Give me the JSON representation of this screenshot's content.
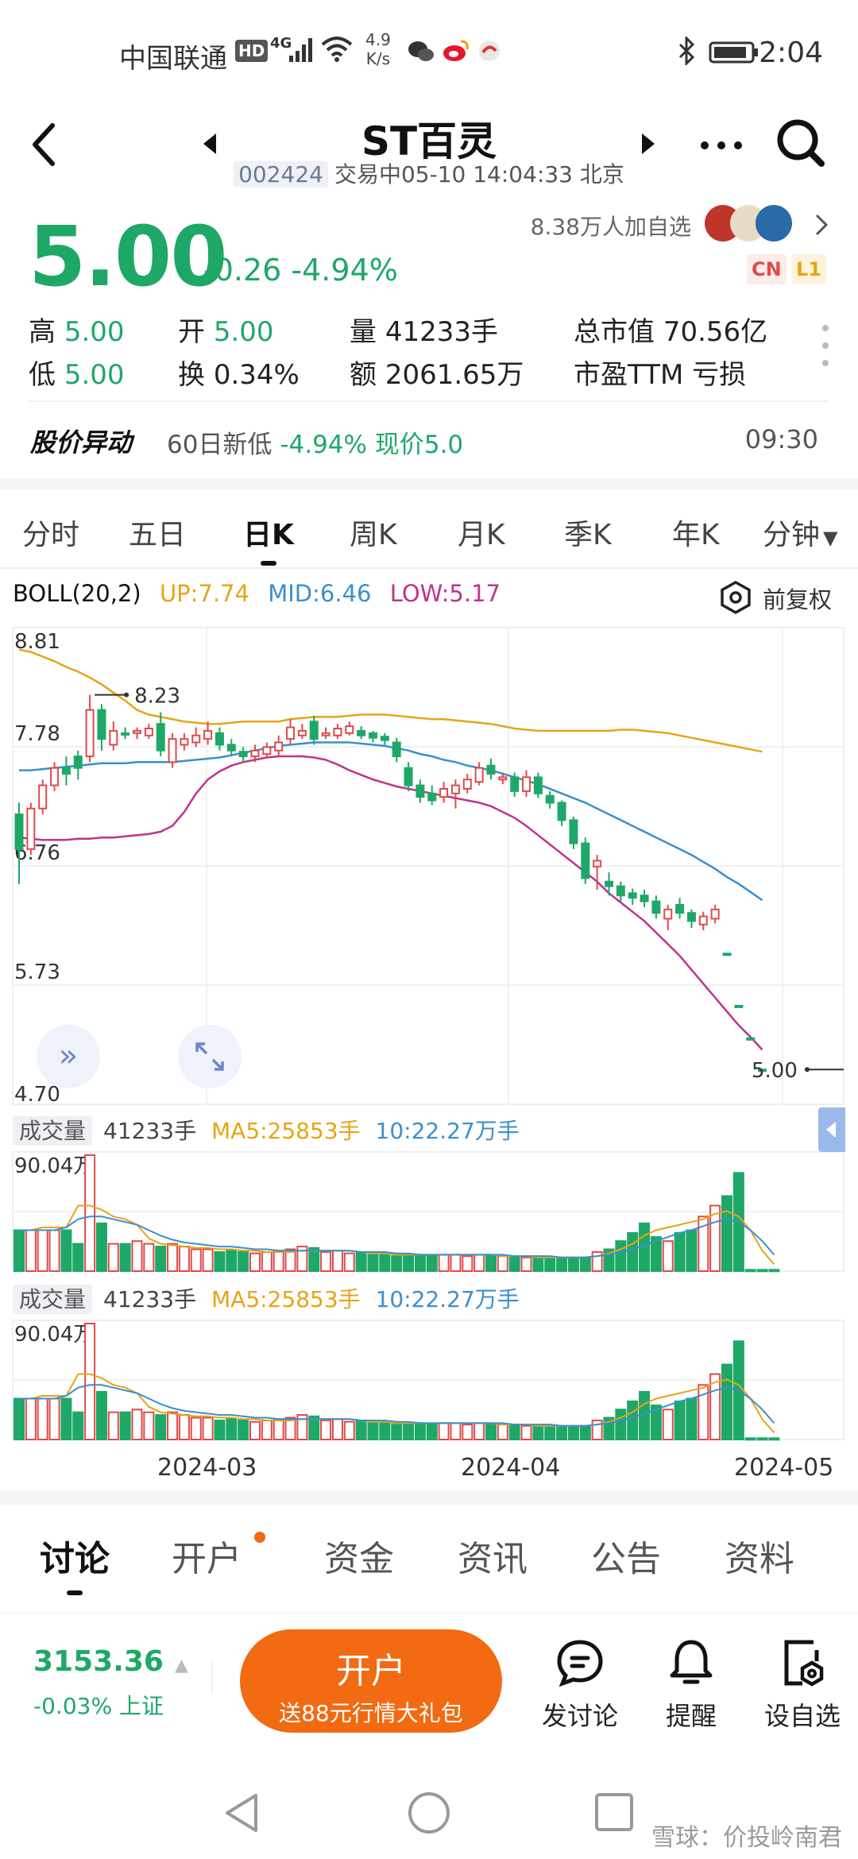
{
  "status_bar": {
    "carrier": "中国联通",
    "hd": "HD",
    "net_gen": "4G",
    "net_speed": "4.9",
    "net_unit": "K/s",
    "time": "2:04"
  },
  "header": {
    "title": "ST百灵",
    "code": "002424",
    "trade_status": "交易中05-10 14:04:33 北京"
  },
  "quote": {
    "price": "5.00",
    "change": "-0.26",
    "change_pct": "-4.94%",
    "followers": "8.38万人加自选",
    "tag_cn": "CN",
    "tag_l1": "L1",
    "high_label": "高",
    "high": "5.00",
    "low_label": "低",
    "low": "5.00",
    "open_label": "开",
    "open": "5.00",
    "turnover_label": "换",
    "turnover": "0.34%",
    "volume_label": "量",
    "volume": "41233手",
    "amount_label": "额",
    "amount": "2061.65万",
    "mktcap_label": "总市值",
    "mktcap": "70.56亿",
    "pe_label": "市盈TTM",
    "pe": "亏损"
  },
  "alert": {
    "title": "股价异动",
    "text_prefix": "60日新低",
    "text_pct": "-4.94%",
    "text_suffix": "现价5.0",
    "time": "09:30"
  },
  "kline_tabs": [
    "分时",
    "五日",
    "日K",
    "周K",
    "月K",
    "季K",
    "年K",
    "分钟"
  ],
  "active_kline_tab": "日K",
  "boll": {
    "label": "BOLL(20,2)",
    "up": "UP:7.74",
    "mid": "MID:6.46",
    "low": "LOW:5.17",
    "adjust": "前复权"
  },
  "colors": {
    "up": "#e04a4a",
    "down": "#1ea868",
    "boll_up": "#e8a317",
    "boll_mid": "#3a8fd0",
    "boll_low": "#c0338a",
    "accent": "#f26a12"
  },
  "chart_data": {
    "type": "candlestick",
    "y_ticks": [
      "8.81",
      "7.78",
      "6.76",
      "5.73",
      "4.70"
    ],
    "ylim": [
      4.7,
      8.81
    ],
    "max_label": "8.23",
    "last_label": "5.00",
    "x_ticks": [
      "2024-03",
      "2024-04",
      "2024-05"
    ],
    "candles": [
      {
        "o": 7.2,
        "c": 6.9,
        "h": 7.3,
        "l": 6.6
      },
      {
        "o": 6.9,
        "c": 7.25,
        "h": 7.3,
        "l": 6.85
      },
      {
        "o": 7.25,
        "c": 7.45,
        "h": 7.5,
        "l": 7.2
      },
      {
        "o": 7.45,
        "c": 7.6,
        "h": 7.65,
        "l": 7.4
      },
      {
        "o": 7.6,
        "c": 7.55,
        "h": 7.7,
        "l": 7.45
      },
      {
        "o": 7.7,
        "c": 7.6,
        "h": 7.75,
        "l": 7.5
      },
      {
        "o": 7.7,
        "c": 8.1,
        "h": 8.23,
        "l": 7.65
      },
      {
        "o": 8.1,
        "c": 7.85,
        "h": 8.15,
        "l": 7.75
      },
      {
        "o": 7.8,
        "c": 7.92,
        "h": 8.0,
        "l": 7.75
      },
      {
        "o": 7.9,
        "c": 7.9,
        "h": 7.95,
        "l": 7.85
      },
      {
        "o": 7.9,
        "c": 7.92,
        "h": 7.95,
        "l": 7.85
      },
      {
        "o": 7.88,
        "c": 7.94,
        "h": 7.98,
        "l": 7.85
      },
      {
        "o": 7.98,
        "c": 7.75,
        "h": 8.08,
        "l": 7.7
      },
      {
        "o": 7.65,
        "c": 7.85,
        "h": 7.9,
        "l": 7.6
      },
      {
        "o": 7.8,
        "c": 7.85,
        "h": 7.9,
        "l": 7.75
      },
      {
        "o": 7.82,
        "c": 7.88,
        "h": 7.95,
        "l": 7.78
      },
      {
        "o": 7.85,
        "c": 7.92,
        "h": 8.0,
        "l": 7.8
      },
      {
        "o": 7.9,
        "c": 7.8,
        "h": 7.95,
        "l": 7.75
      },
      {
        "o": 7.8,
        "c": 7.75,
        "h": 7.85,
        "l": 7.7
      },
      {
        "o": 7.74,
        "c": 7.7,
        "h": 7.78,
        "l": 7.65
      },
      {
        "o": 7.7,
        "c": 7.75,
        "h": 7.8,
        "l": 7.65
      },
      {
        "o": 7.72,
        "c": 7.78,
        "h": 7.82,
        "l": 7.68
      },
      {
        "o": 7.75,
        "c": 7.82,
        "h": 7.88,
        "l": 7.7
      },
      {
        "o": 7.85,
        "c": 7.95,
        "h": 8.02,
        "l": 7.8
      },
      {
        "o": 7.88,
        "c": 7.92,
        "h": 7.98,
        "l": 7.85
      },
      {
        "o": 8.0,
        "c": 7.85,
        "h": 8.05,
        "l": 7.8
      },
      {
        "o": 7.88,
        "c": 7.9,
        "h": 7.95,
        "l": 7.85
      },
      {
        "o": 7.88,
        "c": 7.94,
        "h": 7.98,
        "l": 7.85
      },
      {
        "o": 7.9,
        "c": 7.96,
        "h": 8.0,
        "l": 7.88
      },
      {
        "o": 7.92,
        "c": 7.88,
        "h": 7.96,
        "l": 7.85
      },
      {
        "o": 7.9,
        "c": 7.86,
        "h": 7.92,
        "l": 7.82
      },
      {
        "o": 7.87,
        "c": 7.84,
        "h": 7.9,
        "l": 7.8
      },
      {
        "o": 7.82,
        "c": 7.7,
        "h": 7.86,
        "l": 7.65
      },
      {
        "o": 7.6,
        "c": 7.45,
        "h": 7.65,
        "l": 7.4
      },
      {
        "o": 7.45,
        "c": 7.35,
        "h": 7.5,
        "l": 7.3
      },
      {
        "o": 7.38,
        "c": 7.32,
        "h": 7.45,
        "l": 7.28
      },
      {
        "o": 7.35,
        "c": 7.42,
        "h": 7.48,
        "l": 7.3
      },
      {
        "o": 7.38,
        "c": 7.45,
        "h": 7.5,
        "l": 7.25
      },
      {
        "o": 7.42,
        "c": 7.5,
        "h": 7.55,
        "l": 7.38
      },
      {
        "o": 7.48,
        "c": 7.6,
        "h": 7.65,
        "l": 7.45
      },
      {
        "o": 7.62,
        "c": 7.55,
        "h": 7.68,
        "l": 7.5
      },
      {
        "o": 7.5,
        "c": 7.52,
        "h": 7.56,
        "l": 7.46
      },
      {
        "o": 7.52,
        "c": 7.4,
        "h": 7.56,
        "l": 7.35
      },
      {
        "o": 7.4,
        "c": 7.52,
        "h": 7.58,
        "l": 7.35
      },
      {
        "o": 7.52,
        "c": 7.38,
        "h": 7.56,
        "l": 7.34
      },
      {
        "o": 7.36,
        "c": 7.3,
        "h": 7.4,
        "l": 7.25
      },
      {
        "o": 7.3,
        "c": 7.15,
        "h": 7.32,
        "l": 7.1
      },
      {
        "o": 7.15,
        "c": 6.95,
        "h": 7.18,
        "l": 6.9
      },
      {
        "o": 6.95,
        "c": 6.65,
        "h": 7.0,
        "l": 6.6
      },
      {
        "o": 6.75,
        "c": 6.8,
        "h": 6.85,
        "l": 6.55
      },
      {
        "o": 6.62,
        "c": 6.58,
        "h": 6.7,
        "l": 6.5
      },
      {
        "o": 6.58,
        "c": 6.5,
        "h": 6.62,
        "l": 6.45
      },
      {
        "o": 6.52,
        "c": 6.48,
        "h": 6.56,
        "l": 6.42
      },
      {
        "o": 6.5,
        "c": 6.45,
        "h": 6.55,
        "l": 6.4
      },
      {
        "o": 6.45,
        "c": 6.35,
        "h": 6.5,
        "l": 6.3
      },
      {
        "o": 6.3,
        "c": 6.38,
        "h": 6.42,
        "l": 6.2
      },
      {
        "o": 6.42,
        "c": 6.35,
        "h": 6.48,
        "l": 6.3
      },
      {
        "o": 6.35,
        "c": 6.28,
        "h": 6.38,
        "l": 6.22
      },
      {
        "o": 6.25,
        "c": 6.32,
        "h": 6.36,
        "l": 6.2
      },
      {
        "o": 6.3,
        "c": 6.38,
        "h": 6.42,
        "l": 6.26
      },
      {
        "o": 6.0,
        "c": 6.0,
        "h": 6.0,
        "l": 6.0
      },
      {
        "o": 5.55,
        "c": 5.55,
        "h": 5.55,
        "l": 5.55
      },
      {
        "o": 5.27,
        "c": 5.27,
        "h": 5.27,
        "l": 5.27
      },
      {
        "o": 5.0,
        "c": 5.0,
        "h": 5.0,
        "l": 5.0
      }
    ],
    "boll_up": [
      8.62,
      8.6,
      8.56,
      8.52,
      8.47,
      8.43,
      8.38,
      8.32,
      8.25,
      8.18,
      8.1,
      8.06,
      8.04,
      8.02,
      8.0,
      7.99,
      7.98,
      7.98,
      7.99,
      8.0,
      8.0,
      8.0,
      8.0,
      8.02,
      8.03,
      8.04,
      8.04,
      8.04,
      8.05,
      8.06,
      8.06,
      8.06,
      8.05,
      8.04,
      8.03,
      8.02,
      8.02,
      8.01,
      8.0,
      7.99,
      7.98,
      7.96,
      7.94,
      7.93,
      7.92,
      7.92,
      7.92,
      7.92,
      7.92,
      7.92,
      7.92,
      7.93,
      7.93,
      7.92,
      7.91,
      7.9,
      7.88,
      7.86,
      7.84,
      7.82,
      7.8,
      7.78,
      7.76,
      7.74
    ],
    "boll_mid": [
      7.58,
      7.58,
      7.59,
      7.6,
      7.61,
      7.62,
      7.63,
      7.64,
      7.64,
      7.64,
      7.65,
      7.65,
      7.65,
      7.65,
      7.66,
      7.67,
      7.68,
      7.69,
      7.71,
      7.73,
      7.75,
      7.77,
      7.79,
      7.8,
      7.81,
      7.82,
      7.82,
      7.82,
      7.82,
      7.81,
      7.8,
      7.79,
      7.77,
      7.75,
      7.72,
      7.7,
      7.67,
      7.65,
      7.62,
      7.6,
      7.58,
      7.55,
      7.52,
      7.49,
      7.46,
      7.42,
      7.38,
      7.34,
      7.3,
      7.25,
      7.2,
      7.15,
      7.1,
      7.05,
      7.0,
      6.95,
      6.9,
      6.85,
      6.79,
      6.73,
      6.66,
      6.6,
      6.53,
      6.46
    ],
    "boll_low": [
      7.0,
      6.99,
      6.98,
      6.98,
      6.98,
      6.99,
      6.99,
      7.0,
      7.0,
      7.01,
      7.02,
      7.03,
      7.05,
      7.1,
      7.22,
      7.38,
      7.5,
      7.57,
      7.62,
      7.65,
      7.67,
      7.69,
      7.7,
      7.7,
      7.7,
      7.69,
      7.67,
      7.63,
      7.58,
      7.54,
      7.5,
      7.47,
      7.44,
      7.42,
      7.4,
      7.38,
      7.36,
      7.34,
      7.32,
      7.3,
      7.27,
      7.22,
      7.17,
      7.1,
      7.02,
      6.94,
      6.86,
      6.78,
      6.7,
      6.62,
      6.52,
      6.44,
      6.36,
      6.28,
      6.18,
      6.08,
      5.98,
      5.86,
      5.74,
      5.62,
      5.5,
      5.38,
      5.28,
      5.17
    ],
    "volume": [
      30,
      30,
      30,
      30,
      30,
      20,
      85,
      35,
      20,
      20,
      22,
      20,
      18,
      20,
      18,
      16,
      16,
      14,
      15,
      14,
      13,
      14,
      15,
      16,
      18,
      17,
      14,
      15,
      13,
      14,
      12,
      12,
      11,
      12,
      12,
      11,
      12,
      12,
      11,
      12,
      12,
      11,
      11,
      10,
      10,
      10,
      9,
      9,
      10,
      14,
      16,
      22,
      28,
      35,
      25,
      22,
      28,
      30,
      40,
      48,
      55,
      72,
      1,
      1,
      1
    ],
    "vol_ma5": [
      30,
      30,
      32,
      32,
      32,
      48,
      48,
      45,
      40,
      38,
      34,
      24,
      20,
      19,
      18,
      17,
      17,
      16,
      16,
      15,
      15,
      14,
      14,
      14,
      15,
      15,
      15,
      15,
      15,
      14,
      13,
      13,
      12,
      12,
      12,
      12,
      12,
      12,
      12,
      12,
      12,
      11,
      11,
      11,
      10,
      10,
      10,
      10,
      10,
      11,
      13,
      16,
      20,
      26,
      30,
      32,
      34,
      36,
      38,
      42,
      44,
      40,
      30,
      15,
      5
    ],
    "vol_ma10": [
      30,
      30,
      30,
      30,
      32,
      38,
      40,
      40,
      38,
      36,
      34,
      30,
      26,
      23,
      21,
      20,
      19,
      18,
      18,
      17,
      16,
      16,
      15,
      15,
      15,
      15,
      15,
      15,
      15,
      14,
      14,
      14,
      13,
      13,
      12,
      12,
      12,
      12,
      12,
      12,
      12,
      12,
      11,
      11,
      11,
      11,
      10,
      10,
      10,
      11,
      12,
      14,
      16,
      19,
      22,
      25,
      28,
      30,
      33,
      36,
      38,
      36,
      30,
      22,
      12
    ]
  },
  "volume_panel": {
    "label": "成交量",
    "vol": "41233手",
    "ma5": "MA5:25853手",
    "ma10": "10:22.27万手",
    "max": "90.04万"
  },
  "bottom_tabs": [
    "讨论",
    "开户",
    "资金",
    "资讯",
    "公告",
    "资料"
  ],
  "active_bottom_tab": "讨论",
  "index": {
    "value": "3153.36",
    "change": "-0.03%",
    "name": "上证"
  },
  "open_button": {
    "title": "开户",
    "subtitle": "送88元行情大礼包"
  },
  "actions": [
    {
      "label": "发讨论"
    },
    {
      "label": "提醒"
    },
    {
      "label": "设自选"
    }
  ],
  "watermark": "雪球：价投岭南君"
}
